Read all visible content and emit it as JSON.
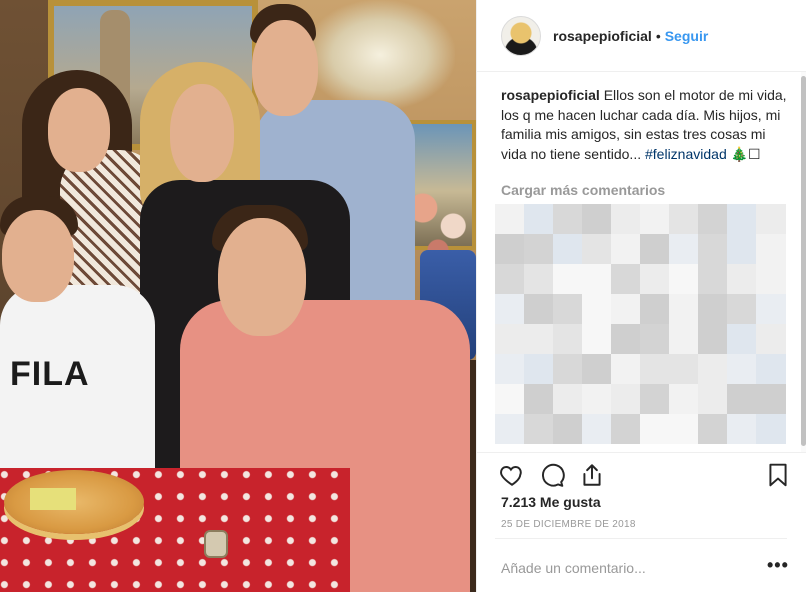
{
  "post": {
    "username": "rosapepioficial",
    "separator": "•",
    "follow_label": "Seguir",
    "caption": {
      "username": "rosapepioficial",
      "text": " Ellos son el motor de mi vida, los q me hacen luchar cada día. Mis hijos, mi familia mis amigos, sin estas tres cosas mi vida no tiene sentido... ",
      "hashtag": "#feliznavidad",
      "emoji": "🎄☐"
    },
    "load_more_label": "Cargar más comentarios",
    "likes": "7.213 Me gusta",
    "date": "25 DE DICIEMBRE DE 2018",
    "comment_placeholder": "Añade un comentario...",
    "more_options": "•••"
  },
  "photo": {
    "shirt_text": "FILA"
  },
  "icons": {
    "like": "heart-icon",
    "comment": "comment-bubble-icon",
    "share": "share-icon",
    "save": "bookmark-icon"
  },
  "colors": {
    "link": "#3897f0",
    "hashtag": "#003569",
    "muted": "#999999"
  }
}
